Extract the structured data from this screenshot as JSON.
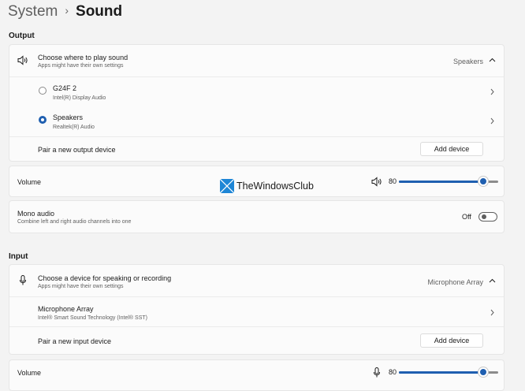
{
  "breadcrumb": {
    "parent": "System",
    "separator": "›",
    "current": "Sound"
  },
  "output": {
    "section_title": "Output",
    "choose": {
      "title": "Choose where to play sound",
      "subtitle": "Apps might have their own settings",
      "selected": "Speakers",
      "icon": "speaker-icon"
    },
    "devices": [
      {
        "name": "G24F 2",
        "desc": "Intel(R) Display Audio",
        "selected": false
      },
      {
        "name": "Speakers",
        "desc": "Realtek(R) Audio",
        "selected": true
      }
    ],
    "pair": {
      "label": "Pair a new output device",
      "button": "Add device"
    }
  },
  "volume_output": {
    "label": "Volume",
    "value": "80",
    "level": 0.8,
    "icon": "speaker-icon"
  },
  "mono": {
    "title": "Mono audio",
    "subtitle": "Combine left and right audio channels into one",
    "state": "Off"
  },
  "watermark": {
    "text": "TheWindowsClub"
  },
  "input": {
    "section_title": "Input",
    "choose": {
      "title": "Choose a device for speaking or recording",
      "subtitle": "Apps might have their own settings",
      "selected": "Microphone Array",
      "icon": "microphone-icon"
    },
    "devices": [
      {
        "name": "Microphone Array",
        "desc": "Intel® Smart Sound Technology (Intel® SST)"
      }
    ],
    "pair": {
      "label": "Pair a new input device",
      "button": "Add device"
    }
  },
  "volume_input": {
    "label": "Volume",
    "value": "80",
    "level": 0.8,
    "icon": "microphone-icon"
  },
  "colors": {
    "accent": "#1f5fb0",
    "background": "#f3f3f3",
    "card": "#fbfbfb"
  }
}
